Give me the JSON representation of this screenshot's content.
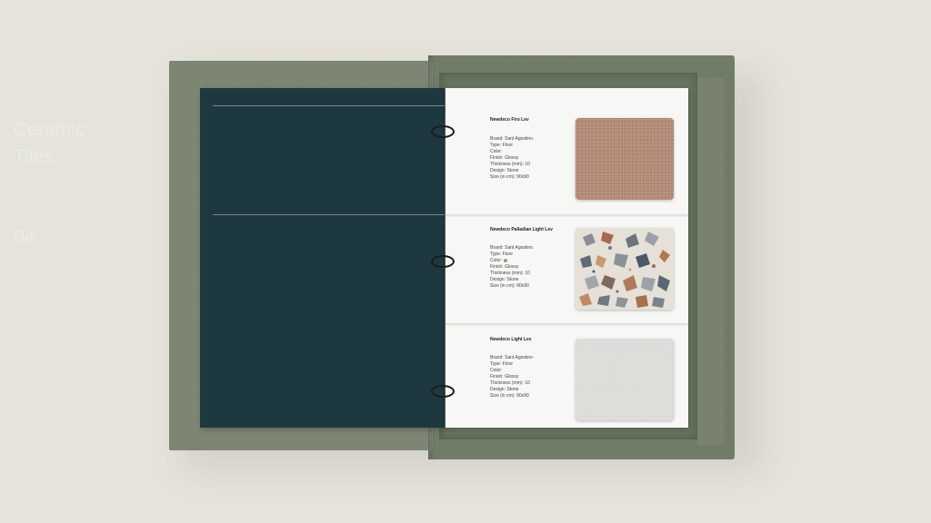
{
  "cover": {
    "title_line1": "Ceramic",
    "title_line2": "Tiles",
    "number": "04"
  },
  "cards": [
    {
      "name": "Newdeco Firo Lev",
      "brand": "Brand: Sant Agostino",
      "type": "Type: Floor",
      "color": "Color:",
      "finish": "Finish:  Glossy",
      "thickness": "Thickness (mm): 10",
      "design": "Design: Stone",
      "size": "Size (in cm): 90x90",
      "swatch_color": "#b58a77"
    },
    {
      "name": "Newdeco Palladian Light Lev",
      "brand": "Brand: Sant Agostino",
      "type": "Type: Floor",
      "color": "Color:",
      "finish": "Finish:  Glossy",
      "thickness": "Thickness (mm): 10",
      "design": "Design: Stone",
      "size": "Size (in cm): 90x90",
      "swatch_color": "#e6e1d8"
    },
    {
      "name": "Newdeco Light Lev",
      "brand": "Brand: Sant Agostino",
      "type": "Type: Floor",
      "color": "Color:",
      "finish": "Finish:  Glossy",
      "thickness": "Thickness (mm): 10",
      "design": "Design: Stone",
      "size": "Size (in cm): 90x90",
      "swatch_color": "#e2e0dc"
    }
  ],
  "colors": {
    "background": "#e6e3db",
    "box_fabric": "#7c8672",
    "cover": "#1e3840",
    "page": "#f7f7f5"
  }
}
